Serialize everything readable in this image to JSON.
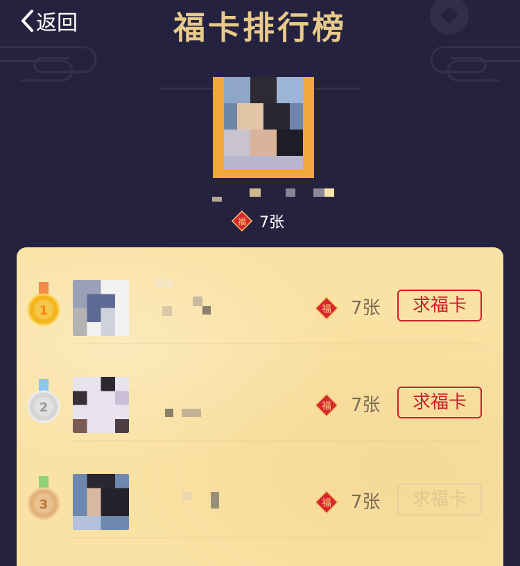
{
  "header": {
    "back_label": "返回",
    "title": "福卡排行榜"
  },
  "hero": {
    "count": "7张"
  },
  "ranking": [
    {
      "rank": "1",
      "count": "7张",
      "button": "求福卡",
      "button_enabled": true
    },
    {
      "rank": "2",
      "count": "7张",
      "button": "求福卡",
      "button_enabled": true
    },
    {
      "rank": "3",
      "count": "7张",
      "button": "求福卡",
      "button_enabled": false
    }
  ],
  "colors": {
    "background": "#25223f",
    "title_gold": "#e7c98a",
    "panel": "#fae2a4",
    "button_red": "#c8202b",
    "medal_gold": "#f4b51c",
    "medal_silver": "#d5d5d5",
    "medal_bronze": "#e3b27a"
  },
  "icons": [
    "back-chevron-icon",
    "fu-card-icon",
    "gold-medal-icon",
    "silver-medal-icon",
    "bronze-medal-icon"
  ]
}
